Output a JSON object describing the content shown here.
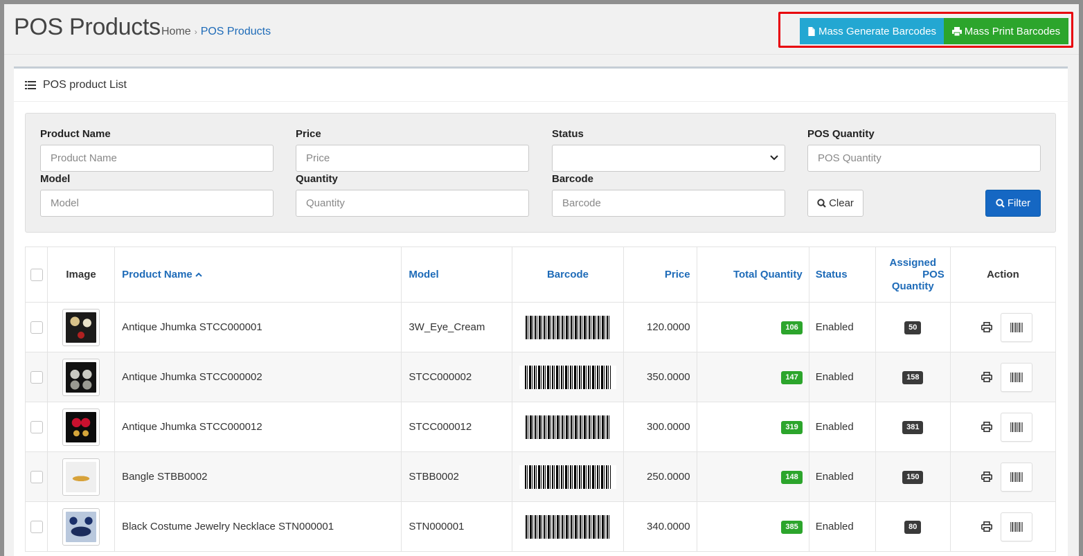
{
  "header": {
    "title": "POS Products",
    "breadcrumb": [
      {
        "label": "Home"
      },
      {
        "label": "POS Products"
      }
    ],
    "actions": {
      "mass_generate": "Mass Generate Barcodes",
      "mass_print": "Mass Print Barcodes"
    }
  },
  "panel": {
    "title": "POS product List"
  },
  "filters": {
    "product_name": {
      "label": "Product Name",
      "placeholder": "Product Name",
      "value": ""
    },
    "price": {
      "label": "Price",
      "placeholder": "Price",
      "value": ""
    },
    "status": {
      "label": "Status",
      "value": ""
    },
    "pos_quantity": {
      "label": "POS Quantity",
      "placeholder": "POS Quantity",
      "value": ""
    },
    "model": {
      "label": "Model",
      "placeholder": "Model",
      "value": ""
    },
    "quantity": {
      "label": "Quantity",
      "placeholder": "Quantity",
      "value": ""
    },
    "barcode": {
      "label": "Barcode",
      "placeholder": "Barcode",
      "value": ""
    },
    "clear_label": "Clear",
    "filter_label": "Filter"
  },
  "table": {
    "columns": {
      "image": "Image",
      "product_name": "Product Name",
      "model": "Model",
      "barcode": "Barcode",
      "price": "Price",
      "total_quantity": "Total Quantity",
      "status": "Status",
      "assigned_pos_line1": "Assigned",
      "assigned_pos_line2": "POS",
      "assigned_pos_line3": "Quantity",
      "action": "Action"
    },
    "rows": [
      {
        "name": "Antique Jhumka STCC000001",
        "model": "3W_Eye_Cream",
        "price": "120.0000",
        "total_qty": "106",
        "status": "Enabled",
        "pos_qty": "50"
      },
      {
        "name": "Antique Jhumka STCC000002",
        "model": "STCC000002",
        "price": "350.0000",
        "total_qty": "147",
        "status": "Enabled",
        "pos_qty": "158"
      },
      {
        "name": "Antique Jhumka STCC000012",
        "model": "STCC000012",
        "price": "300.0000",
        "total_qty": "319",
        "status": "Enabled",
        "pos_qty": "381"
      },
      {
        "name": "Bangle STBB0002",
        "model": "STBB0002",
        "price": "250.0000",
        "total_qty": "148",
        "status": "Enabled",
        "pos_qty": "150"
      },
      {
        "name": "Black Costume Jewelry Necklace STN000001",
        "model": "STN000001",
        "price": "340.0000",
        "total_qty": "385",
        "status": "Enabled",
        "pos_qty": "80"
      }
    ]
  },
  "colors": {
    "accent_blue": "#1567c3",
    "generate_button": "#23a7d2",
    "print_button": "#2ca52c",
    "highlight_box": "#e8000b",
    "link_blue": "#1e6bb8"
  },
  "icons": [
    "file-icon",
    "print-icon",
    "list-icon",
    "search-icon",
    "chevron-down-icon",
    "sort-asc-icon",
    "barcode-icon"
  ]
}
